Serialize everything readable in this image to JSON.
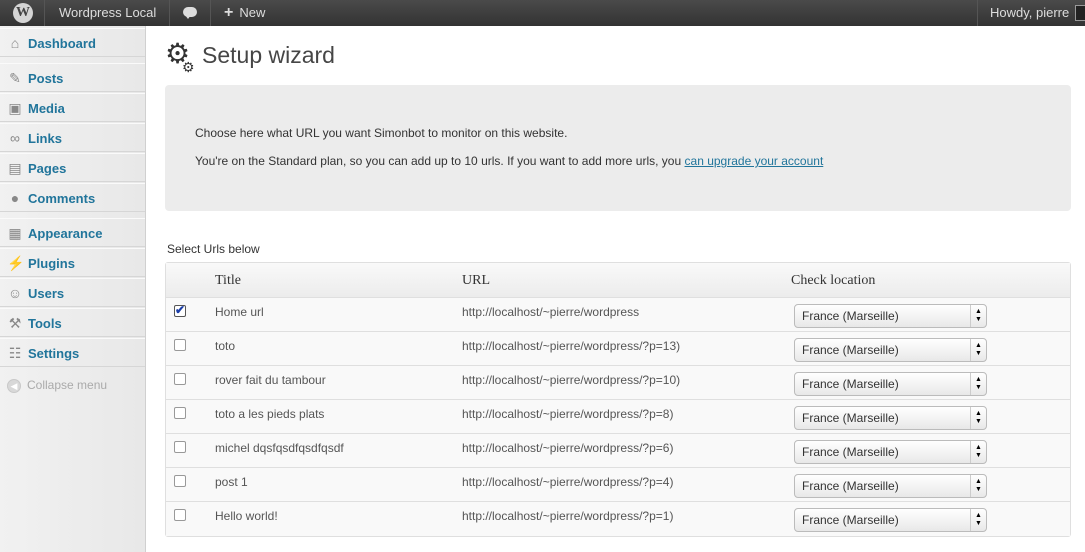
{
  "adminbar": {
    "site_name": "Wordpress Local",
    "new_label": "New",
    "howdy": "Howdy, pierre"
  },
  "sidebar": {
    "items": [
      {
        "label": "Dashboard",
        "icon": "dashboard-icon"
      },
      {
        "label": "Posts",
        "icon": "pin-icon"
      },
      {
        "label": "Media",
        "icon": "media-icon"
      },
      {
        "label": "Links",
        "icon": "link-icon"
      },
      {
        "label": "Pages",
        "icon": "pages-icon"
      },
      {
        "label": "Comments",
        "icon": "comment-icon"
      },
      {
        "label": "Appearance",
        "icon": "appearance-icon"
      },
      {
        "label": "Plugins",
        "icon": "plug-icon"
      },
      {
        "label": "Users",
        "icon": "users-icon"
      },
      {
        "label": "Tools",
        "icon": "tools-icon"
      },
      {
        "label": "Settings",
        "icon": "settings-icon"
      }
    ],
    "collapse_label": "Collapse menu"
  },
  "main": {
    "title": "Setup wizard",
    "notice": {
      "line1": "Choose here what URL you want Simonbot to monitor on this website.",
      "line2": "You're on the Standard plan, so you can add up to 10 urls. If you want to add more urls, you",
      "link": "can upgrade your account"
    },
    "select_label": "Select Urls below",
    "table": {
      "headers": {
        "title": "Title",
        "url": "URL",
        "location": "Check location"
      },
      "rows": [
        {
          "checked": true,
          "title": "Home url",
          "url": "http://localhost/~pierre/wordpress",
          "location": "France (Marseille)"
        },
        {
          "checked": false,
          "title": "toto",
          "url": "http://localhost/~pierre/wordpress/?p=13)",
          "location": "France (Marseille)"
        },
        {
          "checked": false,
          "title": "rover fait du tambour",
          "url": "http://localhost/~pierre/wordpress/?p=10)",
          "location": "France (Marseille)"
        },
        {
          "checked": false,
          "title": "toto a les pieds plats",
          "url": "http://localhost/~pierre/wordpress/?p=8)",
          "location": "France (Marseille)"
        },
        {
          "checked": false,
          "title": "michel dqsfqsdfqsdfqsdf",
          "url": "http://localhost/~pierre/wordpress/?p=6)",
          "location": "France (Marseille)"
        },
        {
          "checked": false,
          "title": "post 1",
          "url": "http://localhost/~pierre/wordpress/?p=4)",
          "location": "France (Marseille)"
        },
        {
          "checked": false,
          "title": "Hello world!",
          "url": "http://localhost/~pierre/wordpress/?p=1)",
          "location": "France (Marseille)"
        }
      ]
    }
  }
}
